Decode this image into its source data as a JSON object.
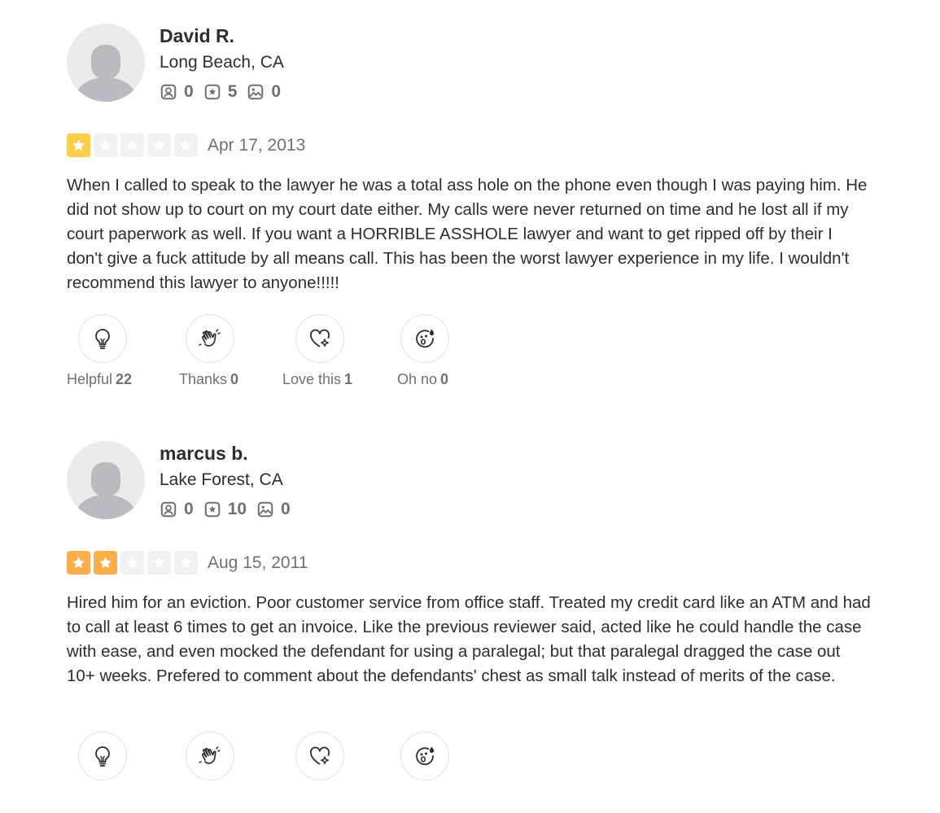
{
  "reviews": [
    {
      "user": {
        "name": "David R.",
        "location": "Long Beach, CA",
        "friends": "0",
        "reviews": "5",
        "photos": "0"
      },
      "rating": 1,
      "star_color": "#ffcc4b",
      "date": "Apr 17, 2013",
      "text": "When I called to speak to the lawyer he was a total ass hole on the phone even though I was paying him. He did not show up to court on my court date either. My calls were never returned on time and he lost all if my court paperwork as well. If you want a HORRIBLE ASSHOLE lawyer and want to get ripped off by their I don't give a fuck attitude by all means call. This has been the worst lawyer experience in my life. I wouldn't recommend this lawyer to anyone!!!!!",
      "reactions": [
        {
          "label": "Helpful",
          "count": "22",
          "icon": "lightbulb-icon"
        },
        {
          "label": "Thanks",
          "count": "0",
          "icon": "waving-hands-icon"
        },
        {
          "label": "Love this",
          "count": "1",
          "icon": "heart-sparkle-icon"
        },
        {
          "label": "Oh no",
          "count": "0",
          "icon": "sweat-face-icon"
        }
      ]
    },
    {
      "user": {
        "name": "marcus b.",
        "location": "Lake Forest, CA",
        "friends": "0",
        "reviews": "10",
        "photos": "0"
      },
      "rating": 2,
      "star_color": "#ffad48",
      "date": "Aug 15, 2011",
      "text": "Hired him for an eviction. Poor customer service from office staff. Treated my credit card like an ATM and had to call at least 6 times to get an invoice. Like the previous reviewer said, acted like he could handle the case with ease, and even mocked the defendant for using a paralegal; but that paralegal dragged the case out 10+ weeks. Prefered to comment about the defendants' chest as small talk instead of merits of the case.",
      "reactions": [
        {
          "label": "",
          "count": "",
          "icon": "lightbulb-icon"
        },
        {
          "label": "",
          "count": "",
          "icon": "waving-hands-icon"
        },
        {
          "label": "",
          "count": "",
          "icon": "heart-sparkle-icon"
        },
        {
          "label": "",
          "count": "",
          "icon": "sweat-face-icon"
        }
      ]
    }
  ]
}
